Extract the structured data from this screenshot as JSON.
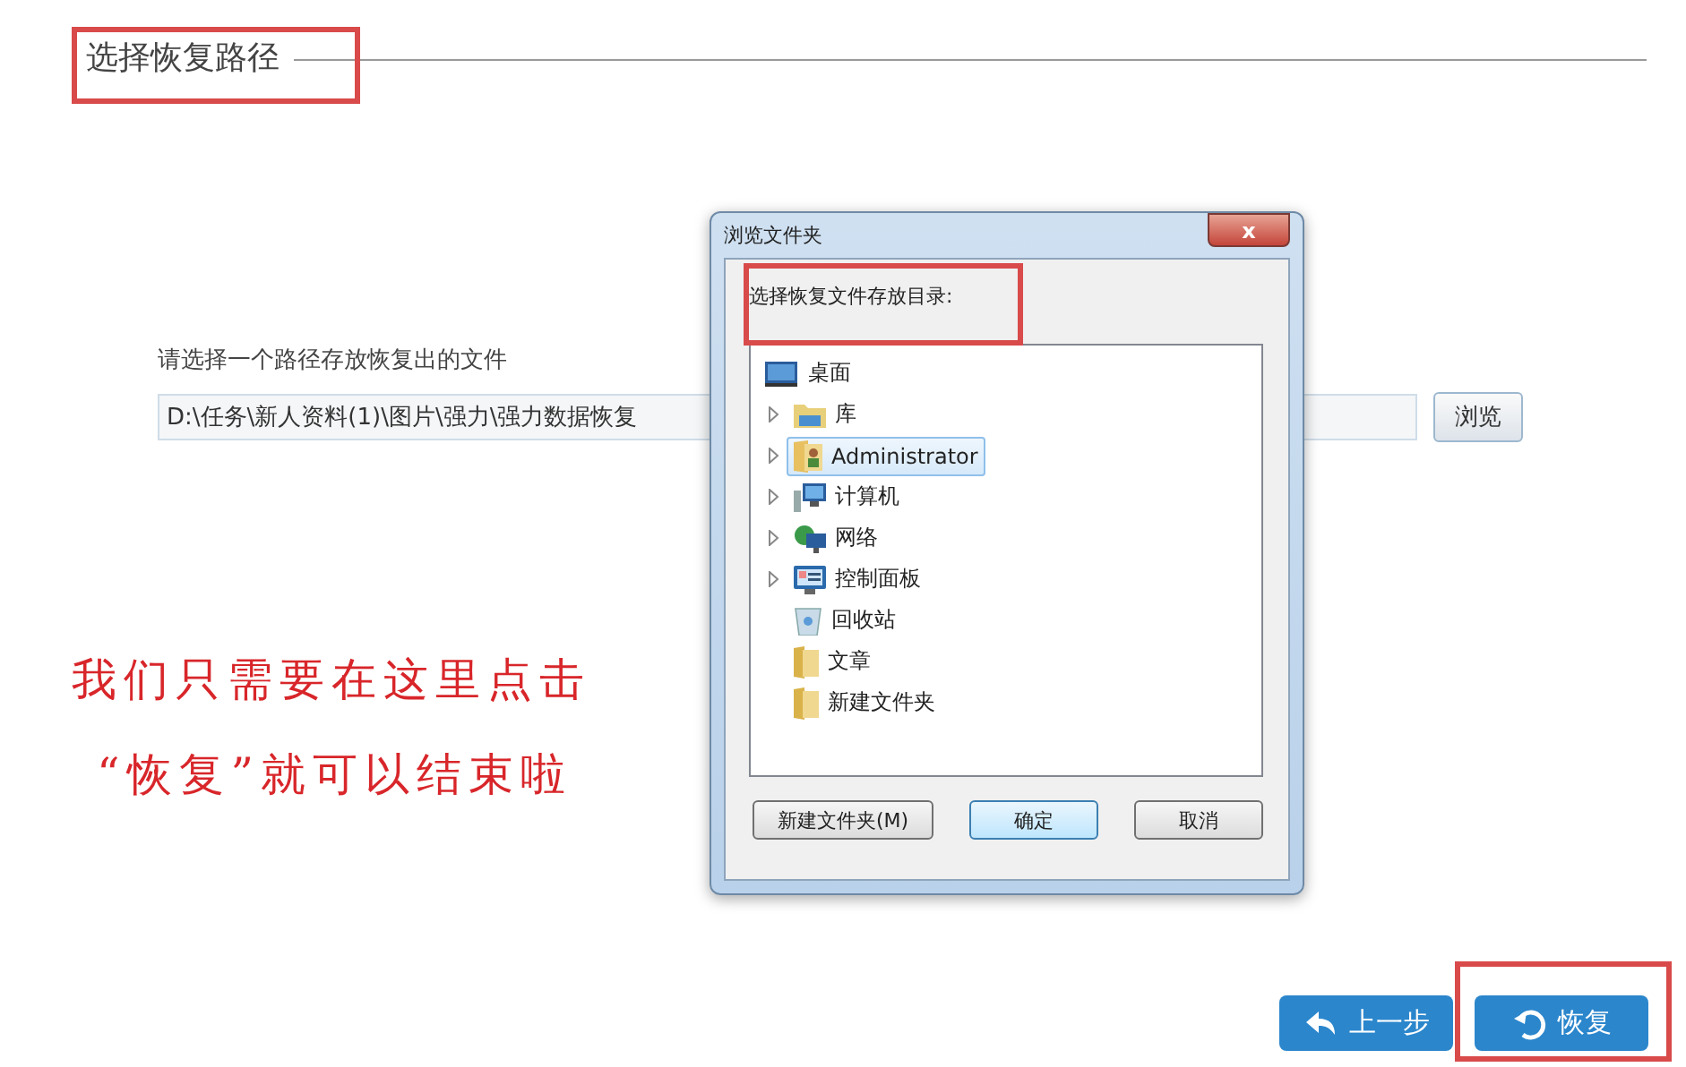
{
  "section_title": "选择恢复路径",
  "path_label": "请选择一个路径存放恢复出的文件",
  "path_field": {
    "value": "D:\\任务\\新人资料(1)\\图片\\强力\\强力数据恢复"
  },
  "browse_button": "浏览",
  "annotation": [
    "我们只需要在这里点击",
    "“恢复”就可以结束啦"
  ],
  "nav_buttons": [
    {
      "label": "上一步",
      "kind": "back"
    },
    {
      "label": "恢复",
      "kind": "restore"
    }
  ],
  "dialog": {
    "title": "浏览文件夹",
    "close": "x",
    "prompt": "选择恢复文件存放目录:",
    "tree": {
      "label": "桌面",
      "expanded": true,
      "children": [
        {
          "label": "库",
          "selected": false,
          "expandable": true
        },
        {
          "label": "Administrator",
          "selected": true,
          "expandable": true
        },
        {
          "label": "计算机",
          "selected": false,
          "expandable": true
        },
        {
          "label": "网络",
          "selected": false,
          "expandable": true
        },
        {
          "label": "控制面板",
          "selected": false,
          "expandable": true
        },
        {
          "label": "回收站",
          "selected": false,
          "expandable": false
        },
        {
          "label": "文章",
          "selected": false,
          "expandable": false
        },
        {
          "label": "新建文件夹",
          "selected": false,
          "expandable": false
        }
      ]
    },
    "buttons": [
      {
        "label": "新建文件夹(M)",
        "default": false
      },
      {
        "label": "确定",
        "default": true
      },
      {
        "label": "取消",
        "default": false
      }
    ]
  }
}
